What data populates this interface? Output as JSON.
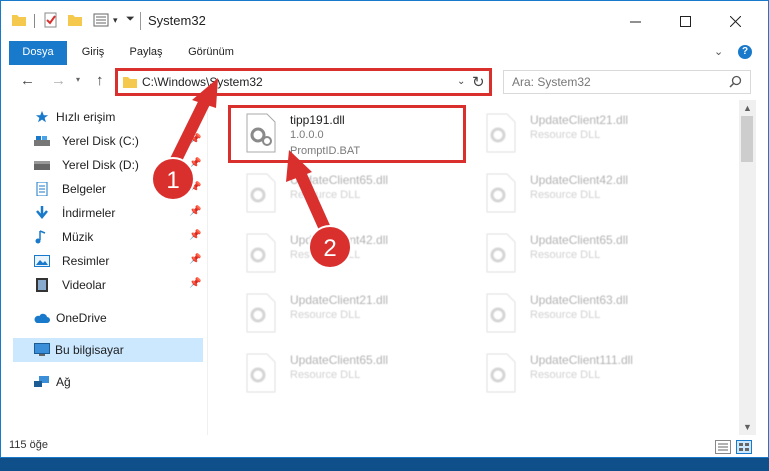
{
  "window": {
    "title": "System32"
  },
  "ribbon": {
    "tabs": [
      "Dosya",
      "Giriş",
      "Paylaş",
      "Görünüm"
    ]
  },
  "nav": {
    "address": "C:\\Windows\\System32",
    "search_placeholder": "Ara: System32"
  },
  "sidebar": {
    "items": [
      {
        "label": "Hızlı erişim",
        "icon": "star-icon"
      },
      {
        "label": "Yerel Disk (C:)",
        "icon": "drive-icon"
      },
      {
        "label": "Yerel Disk (D:)",
        "icon": "drive-icon"
      },
      {
        "label": "Belgeler",
        "icon": "documents-icon"
      },
      {
        "label": "İndirmeler",
        "icon": "download-icon"
      },
      {
        "label": "Müzik",
        "icon": "music-icon"
      },
      {
        "label": "Resimler",
        "icon": "pictures-icon"
      },
      {
        "label": "Videolar",
        "icon": "videos-icon"
      },
      {
        "label": "OneDrive",
        "icon": "cloud-icon"
      },
      {
        "label": "Bu bilgisayar",
        "icon": "computer-icon"
      },
      {
        "label": "Ağ",
        "icon": "network-icon"
      }
    ]
  },
  "files": [
    {
      "name": "tipp191.dll",
      "line1": "1.0.0.0",
      "line2": "PromptID.BAT"
    },
    {
      "name": "UpdateClient21.dll",
      "line1": "Resource DLL"
    },
    {
      "name": "UpdateClient65.dll",
      "line1": "Resource DLL"
    },
    {
      "name": "UpdateClient42.dll",
      "line1": "Resource DLL"
    },
    {
      "name": "UpdateClient42.dll",
      "line1": "Resource DLL"
    },
    {
      "name": "UpdateClient65.dll",
      "line1": "Resource DLL"
    },
    {
      "name": "UpdateClient21.dll",
      "line1": "Resource DLL"
    },
    {
      "name": "UpdateClient63.dll",
      "line1": "Resource DLL"
    },
    {
      "name": "UpdateClient65.dll",
      "line1": "Resource DLL"
    },
    {
      "name": "UpdateClient111.dll",
      "line1": "Resource DLL"
    }
  ],
  "status": {
    "item_count": "115 öğe"
  },
  "annotations": {
    "step1": "1",
    "step2": "2"
  },
  "colors": {
    "accent": "#1979ca",
    "highlight": "#d9302e",
    "selected": "#cce8ff"
  }
}
